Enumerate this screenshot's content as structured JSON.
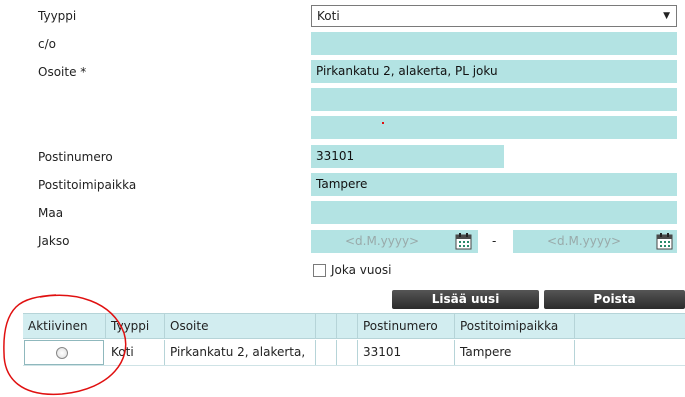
{
  "form": {
    "type_label": "Tyyppi",
    "type_value": "Koti",
    "co_label": "c/o",
    "co_value": "",
    "address_label": "Osoite *",
    "address_line1": "Pirkankatu 2, alakerta, PL joku",
    "address_line2": "",
    "address_line3": "",
    "postal_code_label": "Postinumero",
    "postal_code_value": "33101",
    "city_label": "Postitoimipaikka",
    "city_value": "Tampere",
    "country_label": "Maa",
    "country_value": "",
    "period_label": "Jakso",
    "date_placeholder": "<d.M.yyyy>",
    "period_separator": "-",
    "yearly_label": "Joka vuosi"
  },
  "buttons": {
    "add_label": "Lisää uusi",
    "delete_label": "Poista"
  },
  "table": {
    "headers": [
      "Aktiivinen",
      "Tyyppi",
      "Osoite",
      "",
      "",
      "Postinumero",
      "Postitoimipaikka",
      ""
    ],
    "rows": [
      [
        "",
        "Koti",
        "Pirkankatu 2, alakerta,",
        "",
        "",
        "33101",
        "Tampere",
        ""
      ]
    ]
  },
  "colors": {
    "field_bg": "#b3e3e3",
    "header_bg": "#d2edf0",
    "button_bg": "#333333",
    "annotation": "#e01010"
  }
}
